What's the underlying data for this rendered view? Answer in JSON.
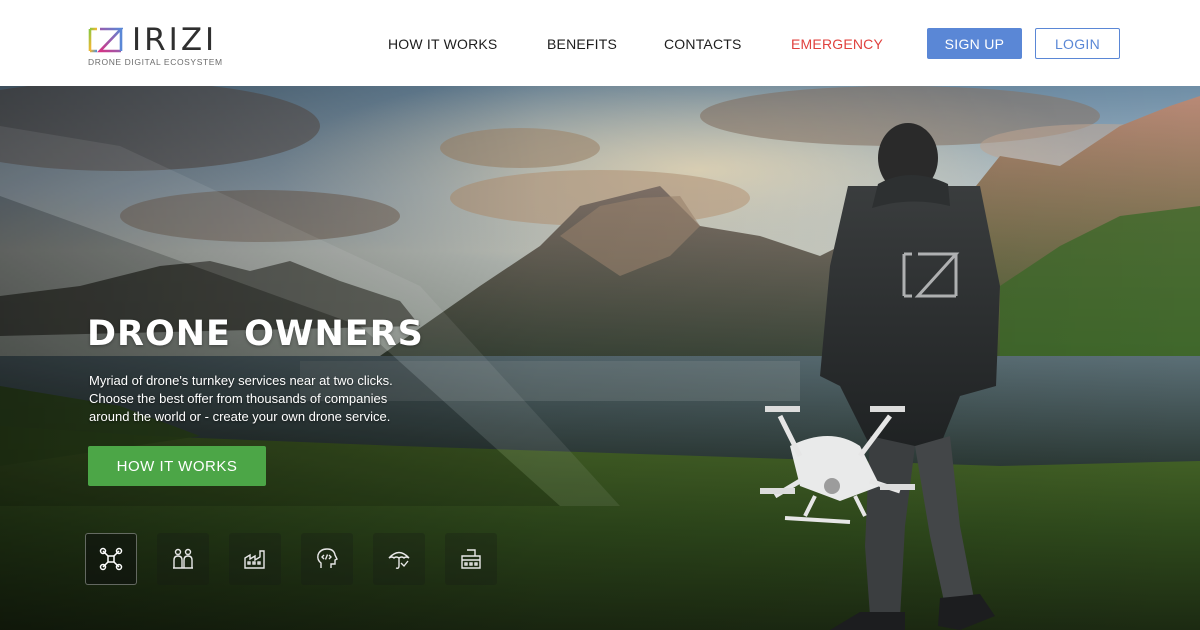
{
  "brand": {
    "name": "IRIZI",
    "tagline": "DRONE DIGITAL ECOSYSTEM"
  },
  "nav": {
    "items": [
      {
        "label": "HOW IT WORKS"
      },
      {
        "label": "BENEFITS"
      },
      {
        "label": "CONTACTS"
      },
      {
        "label": "EMERGENCY"
      }
    ],
    "signup_label": "SIGN UP",
    "login_label": "LOGIN"
  },
  "hero": {
    "title": "DRONE OWNERS",
    "description_lines": [
      "Myriad of drone's turnkey services near at two clicks.",
      "Choose the best offer from thousands of companies",
      "around the world or - create your own drone service."
    ],
    "cta_label": "HOW IT WORKS",
    "jacket_logo": "IZI"
  },
  "service_icons": [
    {
      "icon": "drone-icon",
      "active": true
    },
    {
      "icon": "operators-icon",
      "active": false
    },
    {
      "icon": "industry-icon",
      "active": false
    },
    {
      "icon": "developer-icon",
      "active": false
    },
    {
      "icon": "insurance-umbrella-icon",
      "active": false
    },
    {
      "icon": "payment-terminal-icon",
      "active": false
    }
  ],
  "colors": {
    "brand_blue": "#5a87d6",
    "emergency_red": "#e0413e",
    "cta_green": "#4ca647"
  }
}
